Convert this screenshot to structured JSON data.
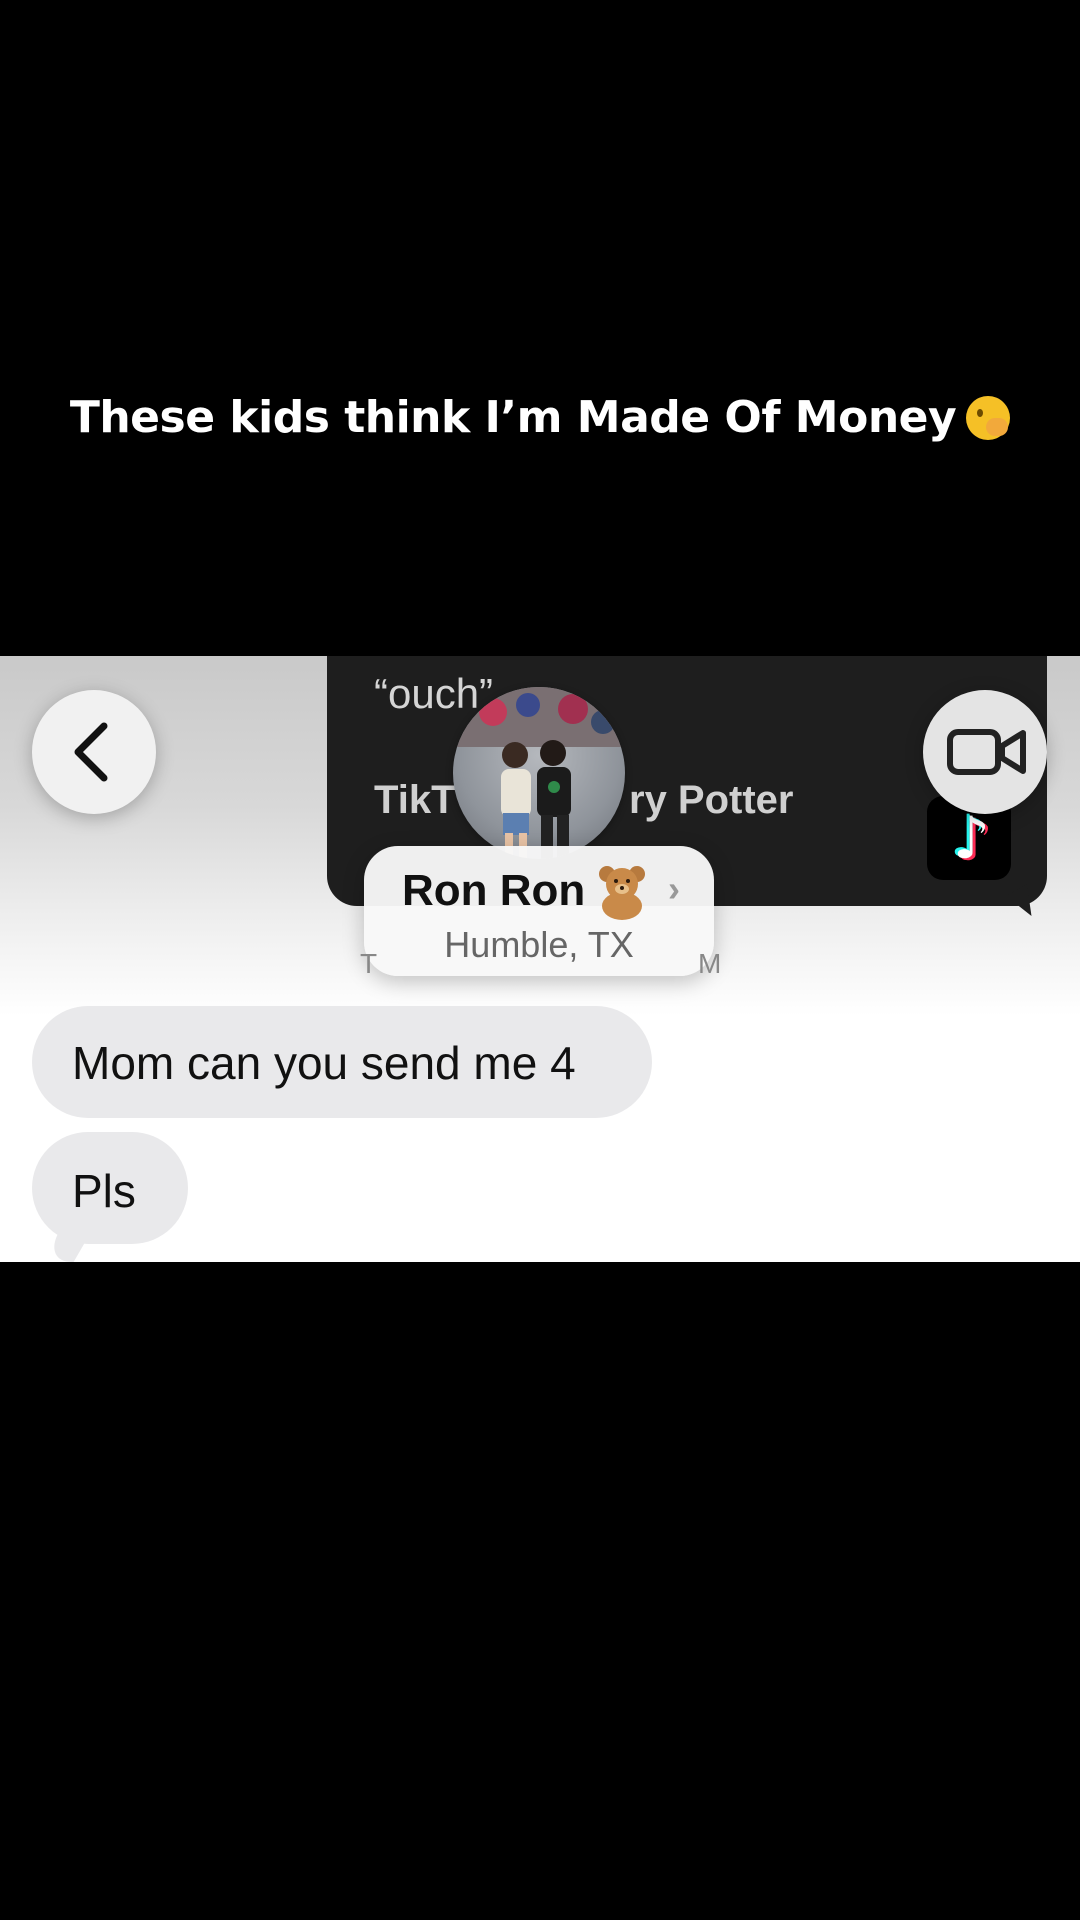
{
  "caption": {
    "text": "These kids think I’m Made Of Money",
    "emoji_icon": "hand-over-mouth-emoji"
  },
  "card": {
    "quote": "“ouch”",
    "title_start": "TikT",
    "title_end": "ry Potter",
    "logo_icon": "tiktok-logo"
  },
  "header": {
    "back_icon": "chevron-left-icon",
    "video_icon": "video-camera-icon",
    "contact_name": "Ron Ron",
    "contact_emoji": "teddy-bear",
    "contact_location": "Humble, TX",
    "chevron": "›",
    "timestamp_left": "T",
    "timestamp_right": "M"
  },
  "messages": [
    {
      "text": "Mom can you send me 4",
      "direction": "incoming"
    },
    {
      "text": "Pls",
      "direction": "incoming"
    }
  ],
  "colors": {
    "bubble_incoming": "#e9e9eb",
    "card_bg": "#1e1e1e",
    "caption_text": "#ffffff"
  }
}
